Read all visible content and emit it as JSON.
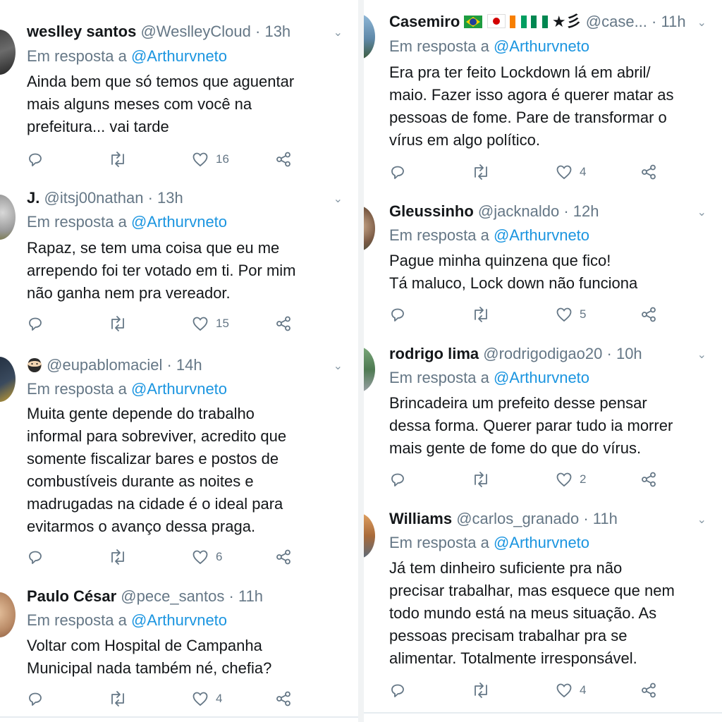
{
  "left_tweets": [
    {
      "name": "weslley santos",
      "handle": "@WeslleyCloud",
      "time": "13h",
      "reply_prefix": "Em resposta a",
      "reply_to": "@Arthurvneto",
      "lines": [
        "Ainda bem que só temos que aguentar",
        "mais alguns meses com você na",
        "prefeitura... vai tarde"
      ],
      "likes": "16"
    },
    {
      "name": "J.",
      "handle": "@itsj00nathan",
      "time": "13h",
      "reply_prefix": "Em resposta a",
      "reply_to": "@Arthurvneto",
      "lines": [
        "Rapaz, se tem uma coisa que eu me",
        "arrependo foi ter votado em ti. Por mim",
        "não ganha nem pra vereador."
      ],
      "likes": "15"
    },
    {
      "name": "",
      "handle": "@eupablomaciel",
      "time": "14h",
      "reply_prefix": "Em resposta a",
      "reply_to": "@Arthurvneto",
      "lines": [
        "Muita gente depende do trabalho",
        "informal para sobreviver, acredito que",
        "somente fiscalizar bares e postos de",
        "combustíveis durante as noites e",
        "madrugadas na cidade é o ideal para",
        "evitarmos o avanço dessa praga."
      ],
      "likes": "6"
    },
    {
      "name": "Paulo César",
      "handle": "@pece_santos",
      "time": "11h",
      "reply_prefix": "Em resposta a",
      "reply_to": "@Arthurvneto",
      "lines": [
        "Voltar com Hospital de Campanha",
        "Municipal nada também né, chefia?"
      ],
      "likes": "4"
    }
  ],
  "right_tweets": [
    {
      "name": "Casemiro",
      "name_flags": "★彡",
      "handle": "@case...",
      "time": "11h",
      "reply_prefix": "Em resposta a",
      "reply_to": "@Arthurvneto",
      "lines": [
        "Era pra ter feito Lockdown lá em abril/",
        "maio. Fazer isso agora é querer matar as",
        "pessoas de fome. Pare de transformar o",
        "vírus em algo político."
      ],
      "likes": "4"
    },
    {
      "name": "Gleussinho",
      "handle": "@jacknaldo",
      "time": "12h",
      "reply_prefix": "Em resposta a",
      "reply_to": "@Arthurvneto",
      "lines": [
        "Pague minha quinzena que fico!",
        "Tá maluco, Lock down não funciona"
      ],
      "likes": "5"
    },
    {
      "name": "rodrigo lima",
      "handle": "@rodrigodigao20",
      "time": "10h",
      "reply_prefix": "Em resposta a",
      "reply_to": "@Arthurvneto",
      "lines": [
        "Brincadeira um prefeito desse  pensar",
        "dessa forma. Querer parar tudo ia morrer",
        "mais gente de fome do que do vírus."
      ],
      "likes": "2"
    },
    {
      "name": "Williams",
      "handle": "@carlos_granado",
      "time": "11h",
      "reply_prefix": "Em resposta a",
      "reply_to": "@Arthurvneto",
      "lines": [
        "Já tem dinheiro suficiente pra não",
        "precisar trabalhar, mas esquece que nem",
        "todo mundo está na meus situação. As",
        "pessoas precisam trabalhar pra se",
        "alimentar. Totalmente irresponsável."
      ],
      "likes": "4"
    }
  ],
  "icons": {
    "reply": "reply-icon",
    "retweet": "retweet-icon",
    "like": "heart-icon",
    "share": "share-icon",
    "menu": "chevron-down-icon"
  },
  "colors": {
    "mention": "#1b95e0",
    "muted": "#657786",
    "text": "#14171a",
    "divider": "#e6ecf0"
  }
}
